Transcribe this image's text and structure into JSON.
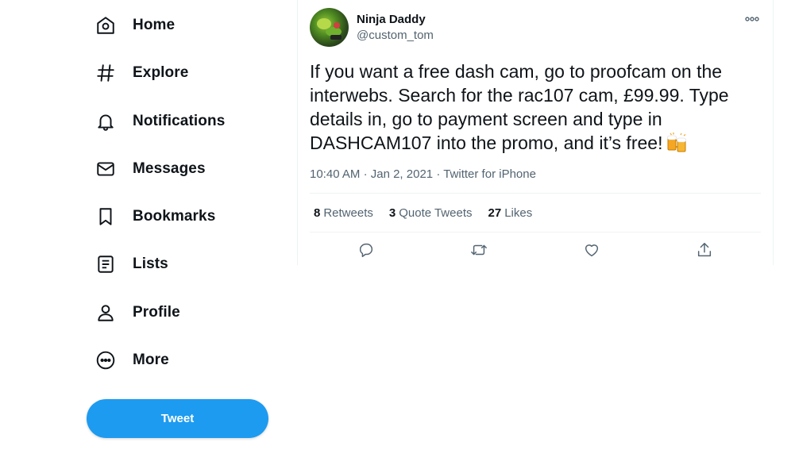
{
  "sidebar": {
    "items": [
      {
        "label": "Home",
        "icon": "home-icon"
      },
      {
        "label": "Explore",
        "icon": "hashtag-icon"
      },
      {
        "label": "Notifications",
        "icon": "bell-icon"
      },
      {
        "label": "Messages",
        "icon": "envelope-icon"
      },
      {
        "label": "Bookmarks",
        "icon": "bookmark-icon"
      },
      {
        "label": "Lists",
        "icon": "list-icon"
      },
      {
        "label": "Profile",
        "icon": "person-icon"
      },
      {
        "label": "More",
        "icon": "more-circle-icon"
      }
    ],
    "tweet_button": "Tweet"
  },
  "tweet": {
    "author": {
      "display_name": "Ninja Daddy",
      "handle": "@custom_tom"
    },
    "text": "If you want a free dash cam, go to proofcam on the interwebs. Search for the rac107 cam, £99.99. Type details in, go to payment screen and type in DASHCAM107 into the promo, and it’s free!",
    "emoji": "beer-mugs-icon",
    "time": "10:40 AM",
    "date": "Jan 2, 2021",
    "source": "Twitter for iPhone",
    "stats": {
      "retweets": {
        "count": "8",
        "label": "Retweets"
      },
      "quotes": {
        "count": "3",
        "label": "Quote Tweets"
      },
      "likes": {
        "count": "27",
        "label": "Likes"
      }
    }
  },
  "colors": {
    "accent": "#1d9bf0",
    "text": "#0f1419",
    "muted": "#536471",
    "border": "#eff3f4"
  }
}
